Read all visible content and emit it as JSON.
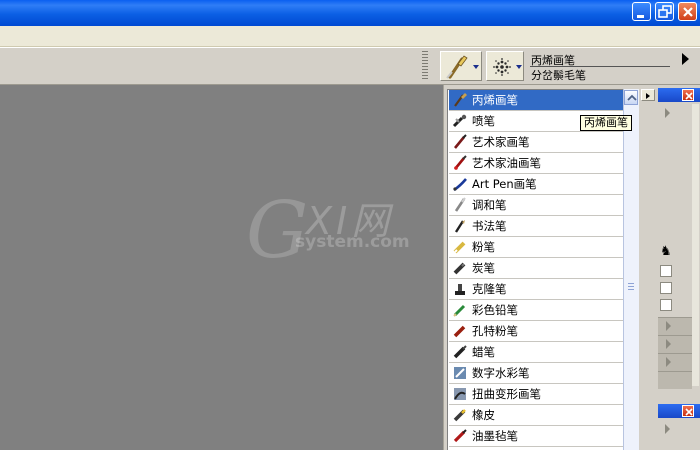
{
  "titlebar": {
    "minimize_icon": "minimize-icon",
    "restore_icon": "restore-icon",
    "close_icon": "close-icon"
  },
  "propbar": {
    "brush_category_icon": "paintbrush-icon",
    "variant_icon": "spray-dots-icon",
    "category_name": "丙烯画笔",
    "variant_name": "分岔鬃毛笔"
  },
  "brush_list": {
    "selected_index": 0,
    "items": [
      {
        "label": "丙烯画笔",
        "icon": "acrylic-brush-icon"
      },
      {
        "label": "喷笔",
        "icon": "airbrush-icon"
      },
      {
        "label": "艺术家画笔",
        "icon": "artist-brush-icon"
      },
      {
        "label": "艺术家油画笔",
        "icon": "artist-oil-brush-icon"
      },
      {
        "label": "Art Pen画笔",
        "icon": "art-pen-icon"
      },
      {
        "label": "调和笔",
        "icon": "blender-icon"
      },
      {
        "label": "书法笔",
        "icon": "calligraphy-pen-icon"
      },
      {
        "label": "粉笔",
        "icon": "chalk-icon"
      },
      {
        "label": "炭笔",
        "icon": "charcoal-icon"
      },
      {
        "label": "克隆笔",
        "icon": "cloner-stamp-icon"
      },
      {
        "label": "彩色铅笔",
        "icon": "colored-pencil-icon"
      },
      {
        "label": "孔特粉笔",
        "icon": "conte-icon"
      },
      {
        "label": "蜡笔",
        "icon": "crayon-icon"
      },
      {
        "label": "数字水彩笔",
        "icon": "digital-watercolor-icon"
      },
      {
        "label": "扭曲变形画笔",
        "icon": "distortion-icon"
      },
      {
        "label": "橡皮",
        "icon": "eraser-icon"
      },
      {
        "label": "油墨毡笔",
        "icon": "felt-pen-icon"
      }
    ]
  },
  "tooltip": {
    "text": "丙烯画笔"
  },
  "watermark": {
    "logo": "GXI网",
    "site": "system.com"
  },
  "colors": {
    "selection": "#316ac5",
    "canvas": "#808080",
    "title_blue": "#0a5ff0"
  }
}
